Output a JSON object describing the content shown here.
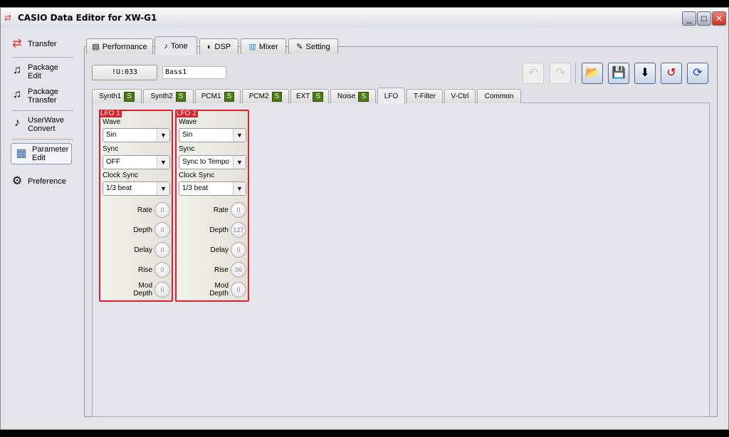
{
  "window": {
    "title": "CASIO Data Editor for XW-G1",
    "buttons": [
      "_",
      "□",
      "✕"
    ]
  },
  "sidebar": {
    "items": [
      {
        "label": "Transfer",
        "icon": "transfer-arrows-icon"
      },
      {
        "label": "Package Edit",
        "icon": "package-edit-icon"
      },
      {
        "label": "Package Transfer",
        "icon": "package-transfer-icon"
      },
      {
        "label": "UserWave Convert",
        "icon": "userwave-icon"
      },
      {
        "label": "Parameter Edit",
        "icon": "parameter-edit-icon",
        "selected": true
      },
      {
        "label": "Preference",
        "icon": "gear-icon"
      }
    ]
  },
  "tabs": [
    {
      "label": "Performance"
    },
    {
      "label": "Tone",
      "selected": true
    },
    {
      "label": "DSP"
    },
    {
      "label": "Mixer"
    },
    {
      "label": "Setting"
    }
  ],
  "patch": {
    "number": "!U:033",
    "name": "Bass1"
  },
  "toolbar": [
    "undo",
    "redo",
    "open",
    "save",
    "write-to-device",
    "load-from-device",
    "sync"
  ],
  "subtabs": [
    {
      "label": "Synth1",
      "badge": "S"
    },
    {
      "label": "Synth2",
      "badge": "S"
    },
    {
      "label": "PCM1",
      "badge": "S"
    },
    {
      "label": "PCM2",
      "badge": "S"
    },
    {
      "label": "EXT",
      "badge": "S"
    },
    {
      "label": "Noise",
      "badge": "S"
    },
    {
      "label": "LFO",
      "selected": true
    },
    {
      "label": "T-Filter"
    },
    {
      "label": "V-Ctrl"
    },
    {
      "label": "Common"
    }
  ],
  "labels": {
    "wave": "Wave",
    "sync": "Sync",
    "clock_sync": "Clock Sync",
    "rate": "Rate",
    "depth": "Depth",
    "delay": "Delay",
    "rise": "Rise",
    "mod_depth": "Mod Depth"
  },
  "lfo": [
    {
      "title": "LFO 1",
      "wave": "Sin",
      "sync": "OFF",
      "clock_sync": "1/3 beat",
      "rate": "0",
      "depth": "0",
      "delay": "0",
      "rise": "0",
      "mod_depth": "0"
    },
    {
      "title": "LFO 2",
      "wave": "Sin",
      "sync": "Sync to Tempo",
      "clock_sync": "1/3 beat",
      "rate": "0",
      "depth": "127",
      "delay": "0",
      "rise": "96",
      "mod_depth": "0"
    }
  ]
}
